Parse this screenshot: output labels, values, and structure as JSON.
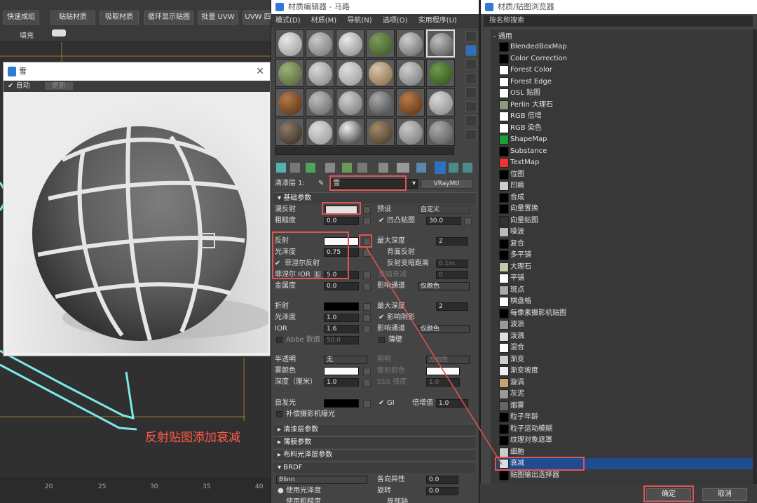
{
  "background_toolbar": {
    "buttons": [
      "快速成组",
      "贴贴材质",
      "吸取材质",
      "循环显示贴图",
      "批量 UVW",
      "UVW 四"
    ],
    "fill_label": "填充"
  },
  "ruler": {
    "ticks": [
      "20",
      "25",
      "30",
      "35",
      "40"
    ]
  },
  "preview_window": {
    "title": "雪",
    "auto_label": "自动",
    "update_label": "更新"
  },
  "caption": "反射贴图添加衰减",
  "material_editor": {
    "title": "材质编辑器 - 马路",
    "menu": [
      "模式(D)",
      "材质(M)",
      "导航(N)",
      "选项(O)",
      "实用程序(U)"
    ],
    "layer_label": "清漆层 1:",
    "material_name": "雪",
    "material_type": "VRayMtl",
    "rollout_basic": "基础参数",
    "diffuse_label": "漫反射",
    "preset_label": "预设",
    "preset_value": "自定义",
    "roughness_label": "粗糙度",
    "roughness_value": "0.0",
    "bump_label": "凹凸贴图",
    "bump_value": "30.0",
    "reflect_label": "反射",
    "max_depth_label": "最大深度",
    "max_depth_value": "2",
    "gloss_label": "光泽度",
    "gloss_value": "0.75",
    "back_reflect_label": "背面反射",
    "fresnel_label": "菲涅尔反射",
    "reflect_dim_label": "反射变暗距离",
    "reflect_dim_value": "0.1m",
    "fresnel_ior_label": "菲涅尔 IOR",
    "fresnel_ior_lock": "L",
    "fresnel_ior_value": "5.0",
    "dim_falloff_label": "变暗衰减",
    "dim_falloff_value": "0",
    "metal_label": "金属度",
    "metal_value": "0.0",
    "affect_channel_label": "影响通道",
    "affect_channel_value": "仅颜色",
    "refract_label": "折射",
    "refract_max_depth_value": "2",
    "refract_gloss_value": "1.0",
    "affect_shadow_label": "影响阴影",
    "ior_label": "IOR",
    "ior_value": "1.6",
    "refract_channel_value": "仅颜色",
    "abbe_label": "Abbe 数值",
    "abbe_value": "50.0",
    "thin_label": "薄壁",
    "translucent_label": "半透明",
    "translucent_value": "无",
    "scatter_label": "照明",
    "scatter_value": "方向性",
    "fog_color_label": "雾颜色",
    "scatter_color_label": "散射颜色",
    "depth_label": "深度（厘米）",
    "depth_value": "1.0",
    "sss_label": "SSS 强度",
    "sss_value": "1.0",
    "selfillum_label": "自发光",
    "gi_label": "GI",
    "multiplier_label": "倍增值",
    "multiplier_value": "1.0",
    "compensate_label": "补偿摄影机曝光",
    "rollouts": [
      "清漆层参数",
      "薄膜参数",
      "布料光泽层参数",
      "BRDF"
    ],
    "brdf_type": "Blinn",
    "anisotropy_label": "各向异性",
    "anisotropy_value": "0.0",
    "use_gloss_label": "使用光泽度",
    "rotation_label": "旋转",
    "rotation_value": "0.0",
    "use_rough_label": "使用粗糙度",
    "local_axis_label": "局部轴"
  },
  "map_browser": {
    "title": "材质/贴图浏览器",
    "search_placeholder": "按名称搜索",
    "group_label": "- 通用",
    "items": [
      "BlendedBoxMap",
      "Color Correction",
      "Forest Color",
      "Forest Edge",
      "OSL 贴图",
      "Perlin 大理石",
      "RGB 倍增",
      "RGB 染色",
      "ShapeMap",
      "Substance",
      "TextMap",
      "位图",
      "凹痕",
      "合成",
      "向量置换",
      "向量贴图",
      "噪波",
      "复合",
      "多平铺",
      "大理石",
      "平铺",
      "斑点",
      "棋盘格",
      "每像素摄影机贴图",
      "波浪",
      "泼溅",
      "混合",
      "渐变",
      "渐变坡度",
      "漩涡",
      "灰泥",
      "烟雾",
      "粒子年龄",
      "粒子运动模糊",
      "纹理对象遮罩",
      "细胞",
      "衰减",
      "贴图输出选择器"
    ],
    "selected_item": "衰减",
    "ok_label": "确定",
    "cancel_label": "取消"
  },
  "colors": {
    "highlight": "#e05454",
    "selected_row": "#1f4c8f",
    "caption": "#ff5a4a"
  }
}
